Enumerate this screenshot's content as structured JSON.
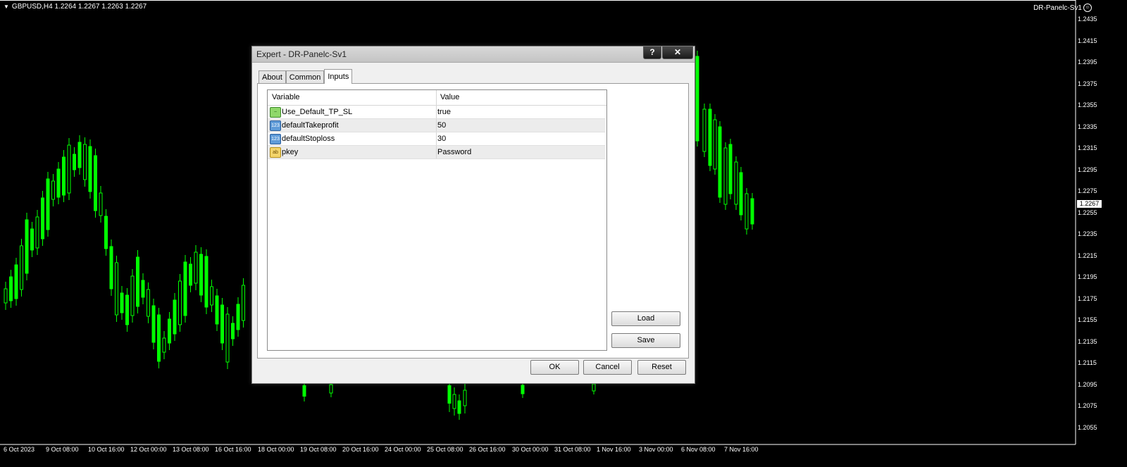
{
  "chart": {
    "symbol_info": "GBPUSD,H4  1.2264 1.2267 1.2263 1.2267",
    "ea_name": "DR-Panelc-Sv1",
    "current_price": "1.2267",
    "price_ticks": [
      "1.2435",
      "1.2415",
      "1.2395",
      "1.2375",
      "1.2355",
      "1.2335",
      "1.2315",
      "1.2295",
      "1.2275",
      "1.2255",
      "1.2235",
      "1.2215",
      "1.2195",
      "1.2175",
      "1.2155",
      "1.2135",
      "1.2115",
      "1.2095",
      "1.2075",
      "1.2055"
    ],
    "date_ticks": [
      "6 Oct 2023",
      "9 Oct 08:00",
      "10 Oct 16:00",
      "12 Oct 00:00",
      "13 Oct 08:00",
      "16 Oct 16:00",
      "18 Oct 00:00",
      "19 Oct 08:00",
      "20 Oct 16:00",
      "24 Oct 00:00",
      "25 Oct 08:00",
      "26 Oct 16:00",
      "30 Oct 00:00",
      "31 Oct 08:00",
      "1 Nov 16:00",
      "3 Nov 00:00",
      "6 Nov 08:00",
      "7 Nov 16:00"
    ],
    "colors": {
      "candle": "#00ff00",
      "background": "#000000",
      "axis": "#ffffff"
    }
  },
  "dialog": {
    "title": "Expert - DR-Panelc-Sv1",
    "help_label": "?",
    "close_label": "✕",
    "tabs": [
      {
        "label": "About"
      },
      {
        "label": "Common"
      },
      {
        "label": "Inputs"
      }
    ],
    "grid": {
      "headers": {
        "variable": "Variable",
        "value": "Value"
      },
      "rows": [
        {
          "icon": "bool-icon",
          "icon_text": "~",
          "variable": "Use_Default_TP_SL",
          "value": "true"
        },
        {
          "icon": "number-icon",
          "icon_text": "123",
          "variable": "defaultTakeprofit",
          "value": "50"
        },
        {
          "icon": "number-icon",
          "icon_text": "123",
          "variable": "defaultStoploss",
          "value": "30"
        },
        {
          "icon": "string-icon",
          "icon_text": "ab",
          "variable": "pkey",
          "value": "Password"
        }
      ]
    },
    "buttons": {
      "load": "Load",
      "save": "Save",
      "ok": "OK",
      "cancel": "Cancel",
      "reset": "Reset"
    }
  }
}
